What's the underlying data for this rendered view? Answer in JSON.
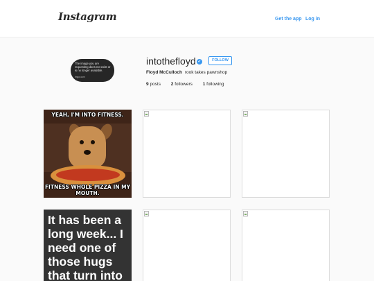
{
  "header": {
    "logo": "Instagram",
    "get_app": "Get the app",
    "login": "Log in"
  },
  "avatar": {
    "error_text": "The image you are requesting does not exist or is no longer available.",
    "small_text": "imgur.com"
  },
  "profile": {
    "username": "intothefloyd",
    "verified_glyph": "✓",
    "follow_label": "FOLLOW",
    "full_name": "Floyd McCulloch",
    "bio": "rook takes pawnshop",
    "posts_count": "9",
    "posts_label": "posts",
    "followers_count": "2",
    "followers_label": "followers",
    "following_count": "1",
    "following_label": "following"
  },
  "posts": {
    "meme1_top": "YEAH, I'M INTO FITNESS.",
    "meme1_bottom": "FITNESS WHOLE PIZZA IN MY MOUTH.",
    "text_post": "It has been a long week... I need one of those hugs that turn into"
  },
  "colors": {
    "accent": "#3897f0",
    "background": "#fafafa"
  }
}
